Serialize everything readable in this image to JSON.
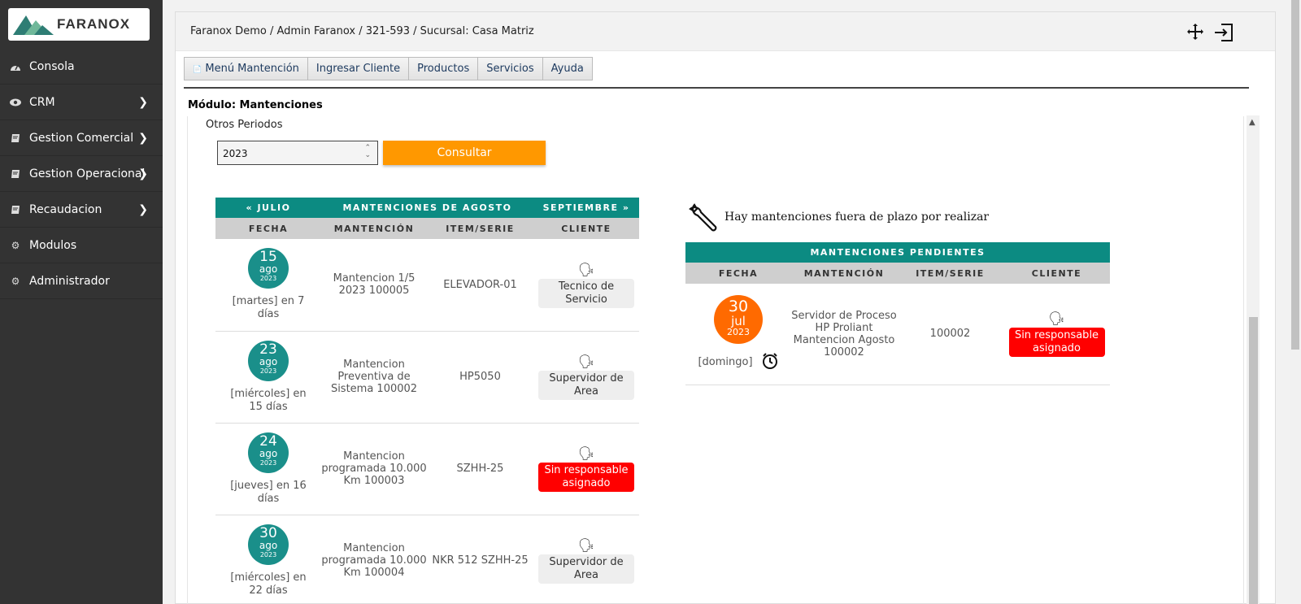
{
  "brand": {
    "name": "FARANOX"
  },
  "sidebar": {
    "items": [
      {
        "label": "Consola",
        "icon": "dashboard-icon",
        "has_submenu": false
      },
      {
        "label": "CRM",
        "icon": "eye-icon",
        "has_submenu": true
      },
      {
        "label": "Gestion Comercial",
        "icon": "book-icon",
        "has_submenu": true
      },
      {
        "label": "Gestion Operacional",
        "icon": "book-icon",
        "has_submenu": true
      },
      {
        "label": "Recaudacion",
        "icon": "book-icon",
        "has_submenu": true
      },
      {
        "label": "Modulos",
        "icon": "cogs-icon",
        "has_submenu": false
      },
      {
        "label": "Administrador",
        "icon": "cogs-icon",
        "has_submenu": false
      }
    ]
  },
  "header": {
    "breadcrumb": "Faranox Demo / Admin Faranox / 321-593 / Sucursal: Casa Matriz",
    "icons": [
      "move-icon",
      "logout-icon"
    ]
  },
  "menubar": {
    "items": [
      "Menú Mantención",
      "Ingresar Cliente",
      "Productos",
      "Servicios",
      "Ayuda"
    ]
  },
  "module": {
    "title": "Módulo: Mantenciones"
  },
  "filter": {
    "label": "Otros Periodos",
    "year_value": "2023",
    "button": "Consultar"
  },
  "calendar": {
    "prev": "« JULIO",
    "title": "MANTENCIONES DE AGOSTO",
    "next": "SEPTIEMBRE »",
    "columns": [
      "FECHA",
      "MANTENCIÓN",
      "ITEM/SERIE",
      "CLIENTE"
    ],
    "rows": [
      {
        "day": "15",
        "month": "ago",
        "year": "2023",
        "sub": "[martes] en 7 días",
        "mantencion": "Mantencion 1/5 2023    100005",
        "item": "ELEVADOR-01",
        "cliente": "Tecnico de Servicio",
        "unassigned": false
      },
      {
        "day": "23",
        "month": "ago",
        "year": "2023",
        "sub": "[miércoles] en 15 días",
        "mantencion": "Mantencion Preventiva de Sistema    100002",
        "item": "HP5050",
        "cliente": "Supervidor de Area",
        "unassigned": false
      },
      {
        "day": "24",
        "month": "ago",
        "year": "2023",
        "sub": "[jueves] en 16 días",
        "mantencion": "Mantencion programada 10.000 Km 100003",
        "item": "SZHH-25",
        "cliente": "Sin responsable asignado",
        "unassigned": true
      },
      {
        "day": "30",
        "month": "ago",
        "year": "2023",
        "sub": "[miércoles] en 22 días",
        "mantencion": "Mantencion programada 10.000 Km 100004",
        "item": "NKR 512 SZHH-25",
        "cliente": "Supervidor de Area",
        "unassigned": false
      }
    ]
  },
  "warning": {
    "text": "Hay mantenciones fuera de plazo por realizar"
  },
  "pending": {
    "title": "MANTENCIONES PENDIENTES",
    "columns": [
      "FECHA",
      "MANTENCIÓN",
      "ITEM/SERIE",
      "CLIENTE"
    ],
    "row": {
      "day": "30",
      "month": "jul",
      "year": "2023",
      "sub": "[domingo]",
      "mantencion": "Servidor de Proceso HP Proliant Mantencion Agosto    100002",
      "item": "100002",
      "cliente": "Sin responsable asignado"
    }
  },
  "colors": {
    "teal": "#0c8b82",
    "orange": "#ff9800",
    "overdue": "#ff6a00",
    "red": "#ff0000",
    "sidebar": "#333333"
  }
}
